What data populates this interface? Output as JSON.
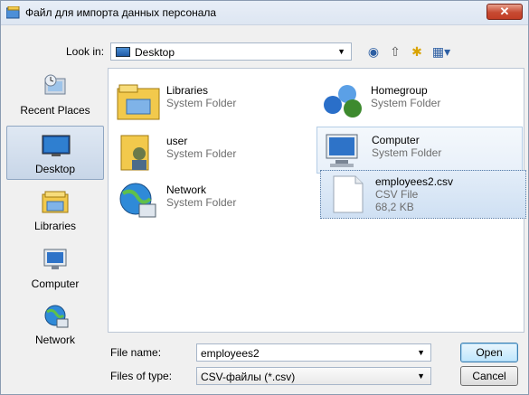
{
  "window": {
    "title": "Файл для импорта данных персонала",
    "close_label": "✕"
  },
  "lookin": {
    "label": "Look in:",
    "value": "Desktop"
  },
  "places": [
    {
      "label": "Recent Places"
    },
    {
      "label": "Desktop"
    },
    {
      "label": "Libraries"
    },
    {
      "label": "Computer"
    },
    {
      "label": "Network"
    }
  ],
  "items": [
    {
      "name": "Libraries",
      "sub1": "System Folder"
    },
    {
      "name": "Homegroup",
      "sub1": "System Folder"
    },
    {
      "name": "user",
      "sub1": "System Folder"
    },
    {
      "name": "Computer",
      "sub1": "System Folder"
    },
    {
      "name": "Network",
      "sub1": "System Folder"
    },
    {
      "name": "employees2.csv",
      "sub1": "CSV File",
      "sub2": "68,2 KB"
    }
  ],
  "filename": {
    "label": "File name:",
    "value": "employees2"
  },
  "filetype": {
    "label": "Files of type:",
    "value": "CSV-файлы (*.csv)"
  },
  "buttons": {
    "open": "Open",
    "cancel": "Cancel"
  }
}
